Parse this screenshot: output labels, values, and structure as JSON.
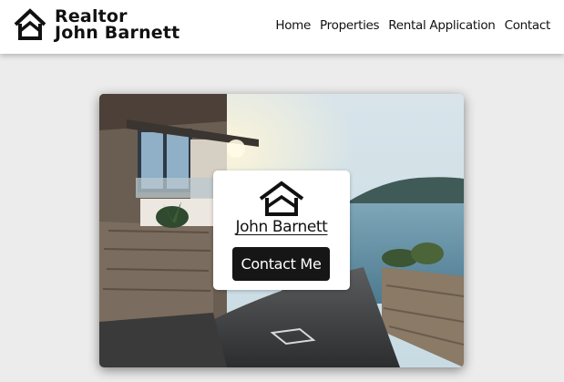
{
  "header": {
    "logo_line1": "Realtor",
    "logo_line2": "John Barnett",
    "logo_icon": "house-icon"
  },
  "nav": {
    "items": [
      {
        "label": "Home"
      },
      {
        "label": "Properties"
      },
      {
        "label": "Rental Application"
      },
      {
        "label": "Contact"
      }
    ]
  },
  "hero": {
    "image": "coastal-villa-photo",
    "card": {
      "icon": "house-icon",
      "name": "John Barnett",
      "button_label": "Contact Me"
    }
  },
  "colors": {
    "background": "#ececec",
    "header": "#ffffff",
    "button": "#161616",
    "text": "#111111"
  }
}
